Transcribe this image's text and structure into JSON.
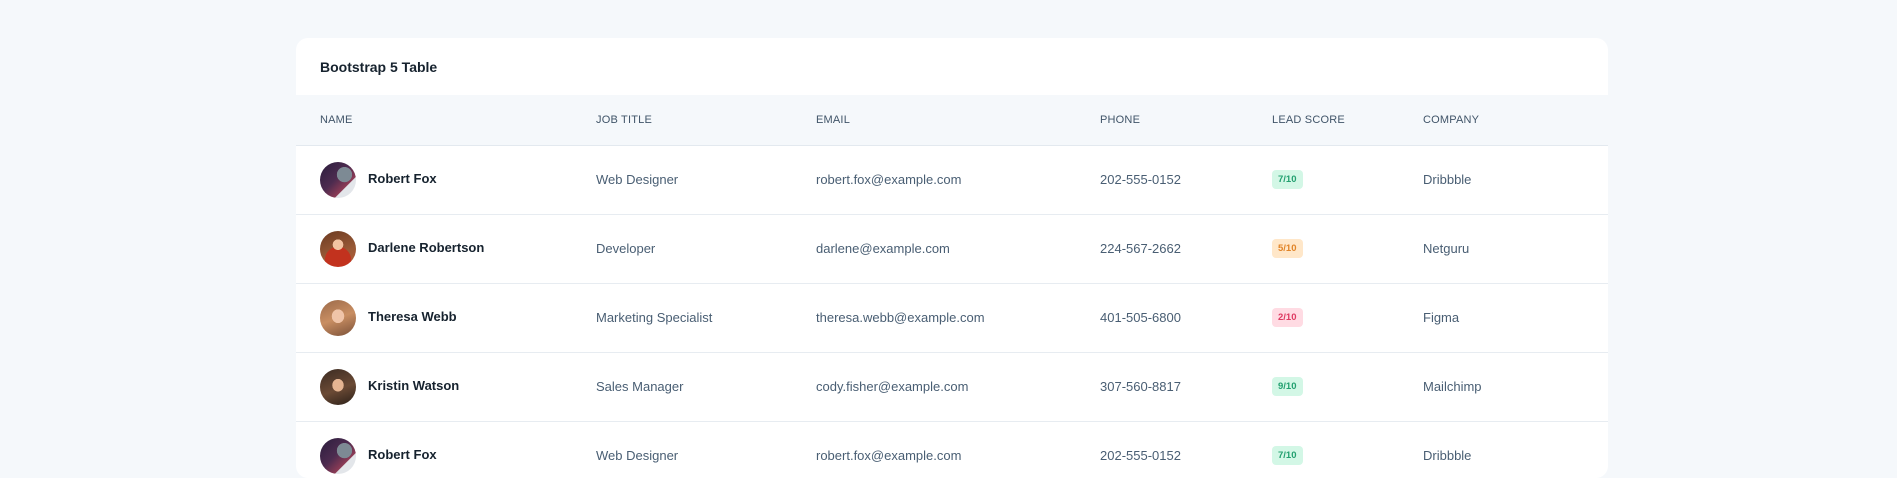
{
  "card": {
    "title": "Bootstrap 5 Table"
  },
  "table": {
    "headers": {
      "name": "NAME",
      "job_title": "JOB TITLE",
      "email": "EMAIL",
      "phone": "PHONE",
      "lead_score": "LEAD SCORE",
      "company": "COMPANY"
    },
    "rows": [
      {
        "name": "Robert Fox",
        "job_title": "Web Designer",
        "email": "robert.fox@example.com",
        "phone": "202-555-0152",
        "lead_score": "7/10",
        "score_color": "#23a070",
        "company": "Dribbble"
      },
      {
        "name": "Darlene Robertson",
        "job_title": "Developer",
        "email": "darlene@example.com",
        "phone": "224-567-2662",
        "lead_score": "5/10",
        "score_color": "#e18428",
        "company": "Netguru"
      },
      {
        "name": "Theresa Webb",
        "job_title": "Marketing Specialist",
        "email": "theresa.webb@example.com",
        "phone": "401-505-6800",
        "lead_score": "2/10",
        "score_color": "#de3a62",
        "company": "Figma"
      },
      {
        "name": "Kristin Watson",
        "job_title": "Sales Manager",
        "email": "cody.fisher@example.com",
        "phone": "307-560-8817",
        "lead_score": "9/10",
        "score_color": "#23a070",
        "company": "Mailchimp"
      },
      {
        "name": "Robert Fox",
        "job_title": "Web Designer",
        "email": "robert.fox@example.com",
        "phone": "202-555-0152",
        "lead_score": "7/10",
        "score_color": "#23a070",
        "company": "Dribbble"
      }
    ]
  }
}
